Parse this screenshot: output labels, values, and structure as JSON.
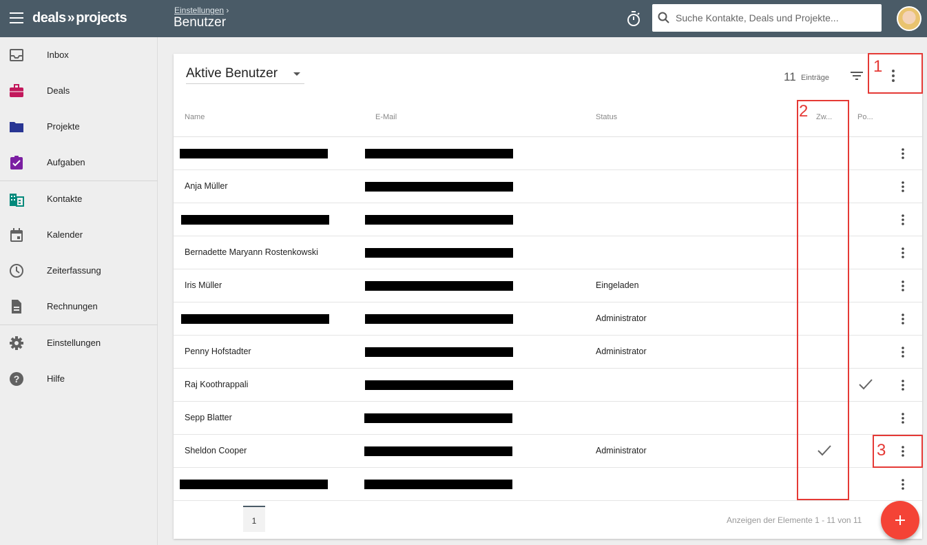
{
  "app": {
    "logo_left": "deals",
    "logo_mid": "»",
    "logo_right": "projects"
  },
  "header": {
    "breadcrumb": "Einstellungen",
    "breadcrumb_sep": "›",
    "title": "Benutzer"
  },
  "search": {
    "placeholder": "Suche Kontakte, Deals und Projekte..."
  },
  "sidebar": {
    "items": [
      {
        "label": "Inbox",
        "icon": "inbox-icon",
        "color": "#616161"
      },
      {
        "label": "Deals",
        "icon": "briefcase-icon",
        "color": "#c2185b"
      },
      {
        "label": "Projekte",
        "icon": "folder-icon",
        "color": "#283593"
      },
      {
        "label": "Aufgaben",
        "icon": "assignment-icon",
        "color": "#7b1fa2"
      },
      {
        "label": "Kontakte",
        "icon": "business-icon",
        "color": "#00897b"
      },
      {
        "label": "Kalender",
        "icon": "calendar-icon",
        "color": "#616161"
      },
      {
        "label": "Zeiterfassung",
        "icon": "clock-icon",
        "color": "#616161"
      },
      {
        "label": "Rechnungen",
        "icon": "document-icon",
        "color": "#616161"
      },
      {
        "label": "Einstellungen",
        "icon": "gear-icon",
        "color": "#616161"
      },
      {
        "label": "Hilfe",
        "icon": "help-icon",
        "color": "#616161"
      }
    ]
  },
  "list": {
    "view_label": "Aktive Benutzer",
    "count": "11",
    "count_label": "Einträge",
    "columns": {
      "name": "Name",
      "email": "E-Mail",
      "status": "Status",
      "zw": "Zw...",
      "po": "Po..."
    },
    "rows": [
      {
        "name": "",
        "name_redacted": true,
        "status": "",
        "zw": false,
        "po": false
      },
      {
        "name": "Anja Müller",
        "name_redacted": false,
        "status": "",
        "zw": false,
        "po": false
      },
      {
        "name": "",
        "name_redacted": true,
        "status": "",
        "zw": false,
        "po": false
      },
      {
        "name": "Bernadette Maryann Rostenkowski",
        "name_redacted": false,
        "status": "",
        "zw": false,
        "po": false
      },
      {
        "name": "Iris Müller",
        "name_redacted": false,
        "status": "Eingeladen",
        "zw": false,
        "po": false
      },
      {
        "name": "",
        "name_redacted": true,
        "status": "Administrator",
        "zw": false,
        "po": false
      },
      {
        "name": "Penny Hofstadter",
        "name_redacted": false,
        "status": "Administrator",
        "zw": false,
        "po": false
      },
      {
        "name": "Raj Koothrappali",
        "name_redacted": false,
        "status": "",
        "zw": false,
        "po": true
      },
      {
        "name": "Sepp Blatter",
        "name_redacted": false,
        "status": "",
        "zw": false,
        "po": false
      },
      {
        "name": "Sheldon Cooper",
        "name_redacted": false,
        "status": "Administrator",
        "zw": true,
        "po": false
      },
      {
        "name": "",
        "name_redacted": true,
        "status": "",
        "zw": false,
        "po": false
      }
    ],
    "pager": {
      "page": "1",
      "info": "Anzeigen der Elemente 1 - 11 von 11"
    }
  },
  "annotations": {
    "one": "1",
    "two": "2",
    "three": "3",
    "color": "#e53935"
  }
}
